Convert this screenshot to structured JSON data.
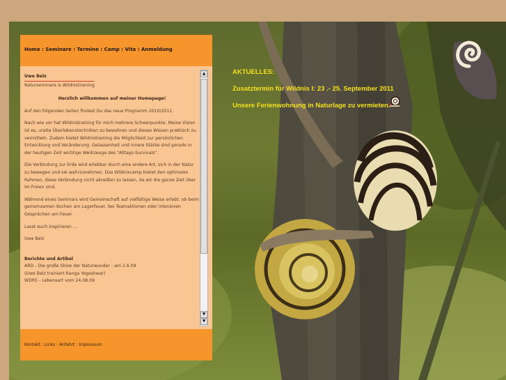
{
  "nav": {
    "items": [
      {
        "label": "Home"
      },
      {
        "label": "Seminare"
      },
      {
        "label": "Termine"
      },
      {
        "label": "Camp"
      },
      {
        "label": "Vita"
      },
      {
        "label": "Anmeldung"
      }
    ],
    "separator": " : "
  },
  "content": {
    "name": "Uwe Belz",
    "subtitle": "Naturseminare & Wildnistraining",
    "welcome": "Herzlich willkommen auf meiner Homepage!",
    "paragraphs": [
      "Auf den folgenden Seiten findest Du das neue Programm 2010/2011.",
      "Nach wie vor hat Wildnistraining für mich mehrere Schwerpunkte. Meine Vision ist es, uralte Überlebenstechniken zu bewahren und dieses Wissen praktisch zu vermitteln. Zudem bietet Wildnistraining die Möglichkeit zur persönlichen Entwicklung und Veränderung. Gelassenheit und innere Stärke sind gerade in der heutigen Zeit wichtige Werkzeuge des \"Alltags-Survivals\".",
      "Die Verbindung zur Erde wird erlebbar durch eine andere Art, sich in der Natur zu bewegen und sie wahrzunehmen. Das Wildniscamp bietet den optimalen Rahmen, diese Verbindung nicht abreißen zu lassen, da wir die ganze Zeit über im Freien sind.",
      "Während eines Seminars wird Gemeinschaft auf vielfältige Weise erlebt: ob beim gemeinsamen Kochen am Lagerfeuer, bei Teamaktionen oder intensiven Gesprächen am Feuer.",
      "Lasst euch inspirieren ...",
      "Uwe Belz"
    ],
    "articles_heading": "Berichte und Artikel",
    "articles": [
      "ARD - Die große Show der Naturwunder - am 2.6.09",
      "(Uwe Belz trainiert Ranga Yogeshwar)",
      "WDR5 - Lebensart vom 24.08.09"
    ]
  },
  "scrollbar": {
    "up_icon": "▲",
    "down_icon": "▼"
  },
  "footer": {
    "items": [
      {
        "label": "Kontakt"
      },
      {
        "label": "Links"
      },
      {
        "label": "Anfahrt"
      },
      {
        "label": "Impressum"
      }
    ],
    "separator": " : "
  },
  "news": {
    "heading": "AKTUELLES:",
    "item1": "Zusatztermin für Wildnis I: 23 .- 25. September 2011",
    "item2": "Unsere Ferienwohnung in Naturlage zu vermieten."
  },
  "colors": {
    "page_background": "#cca77e",
    "nav_orange": "#f5952c",
    "content_peach": "#f9c593",
    "news_yellow": "#f4e11b",
    "logo_cream": "#f3ead7"
  },
  "icons": {
    "logo": "spiral-snail-logo-icon",
    "news_marker": "snail-icon"
  }
}
